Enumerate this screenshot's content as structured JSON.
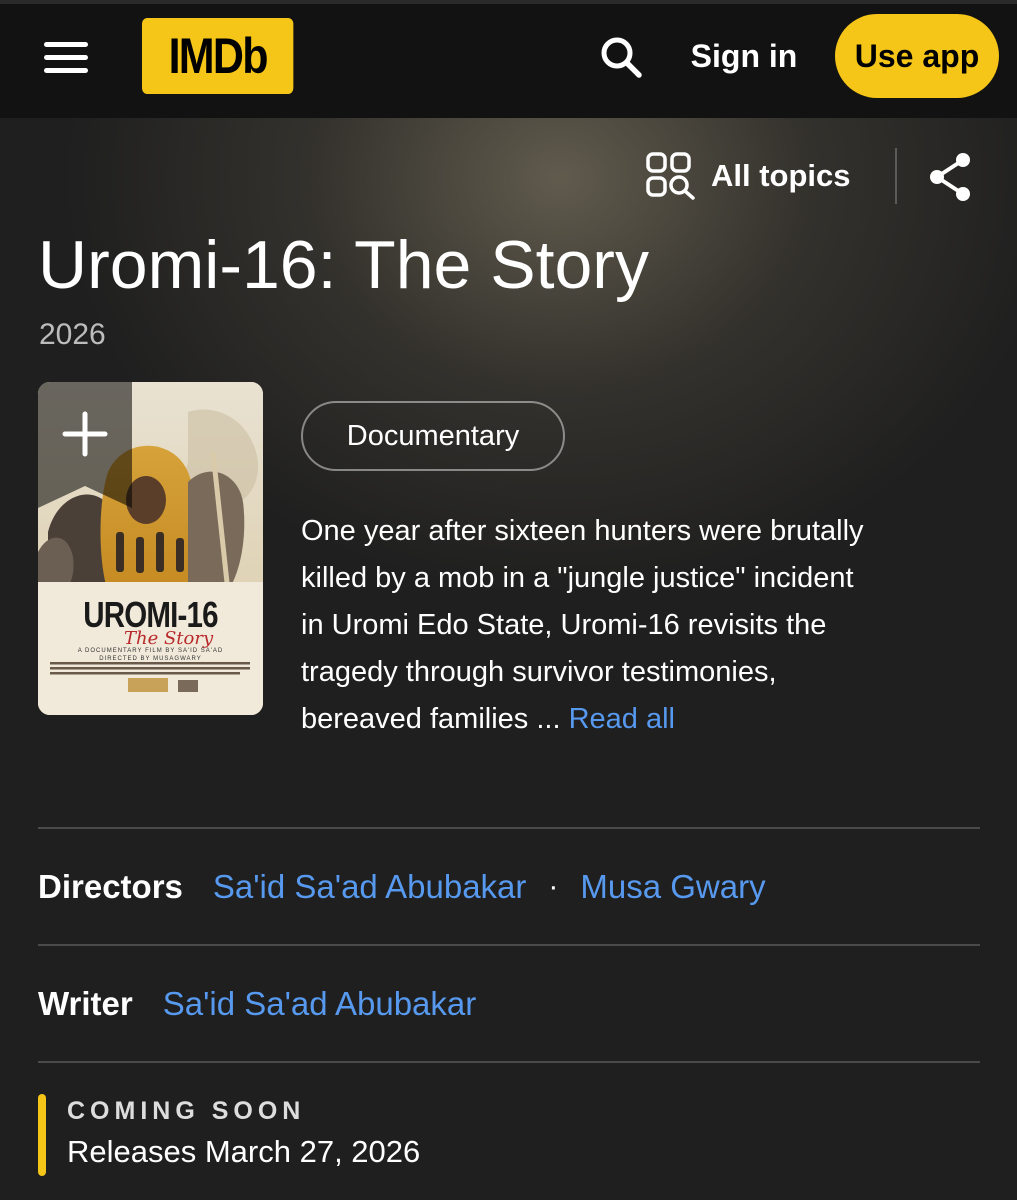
{
  "header": {
    "logo_text": "IMDb",
    "signin_label": "Sign in",
    "useapp_label": "Use app",
    "menu_icon": "hamburger-menu-icon",
    "search_icon": "search-icon"
  },
  "toolbar": {
    "alltopics_label": "All topics",
    "alltopics_icon": "grid-search-icon",
    "share_icon": "share-icon"
  },
  "title": {
    "name": "Uromi-16: The Story",
    "year": "2026"
  },
  "poster": {
    "title_text": "UROMI-16",
    "subtitle_text": "The Story",
    "tagline": "A DOCUMENTARY FILM BY SA'ID SA'AD",
    "directed_by": "DIRECTED BY MUSAGWARY",
    "add_icon": "plus-icon"
  },
  "genre": "Documentary",
  "plot": {
    "lines": [
      "One year after sixteen hunters were brutally",
      "killed by a mob in a \"jungle justice\" incident",
      "in Uromi Edo State, Uromi-16 revisits the",
      "tragedy through survivor testimonies,"
    ],
    "last_line": "bereaved families ...",
    "read_all": "Read all"
  },
  "credits": {
    "directors_label": "Directors",
    "directors": [
      "Sa'id Sa'ad Abubakar",
      "Musa Gwary"
    ],
    "separator": "·",
    "writer_label": "Writer",
    "writer": "Sa'id Sa'ad Abubakar"
  },
  "coming_soon": {
    "label": "COMING SOON",
    "release": "Releases March 27, 2026"
  },
  "colors": {
    "accent": "#f5c518",
    "link": "#5799ef",
    "topbar": "#121212",
    "background": "#1f1f1f"
  }
}
